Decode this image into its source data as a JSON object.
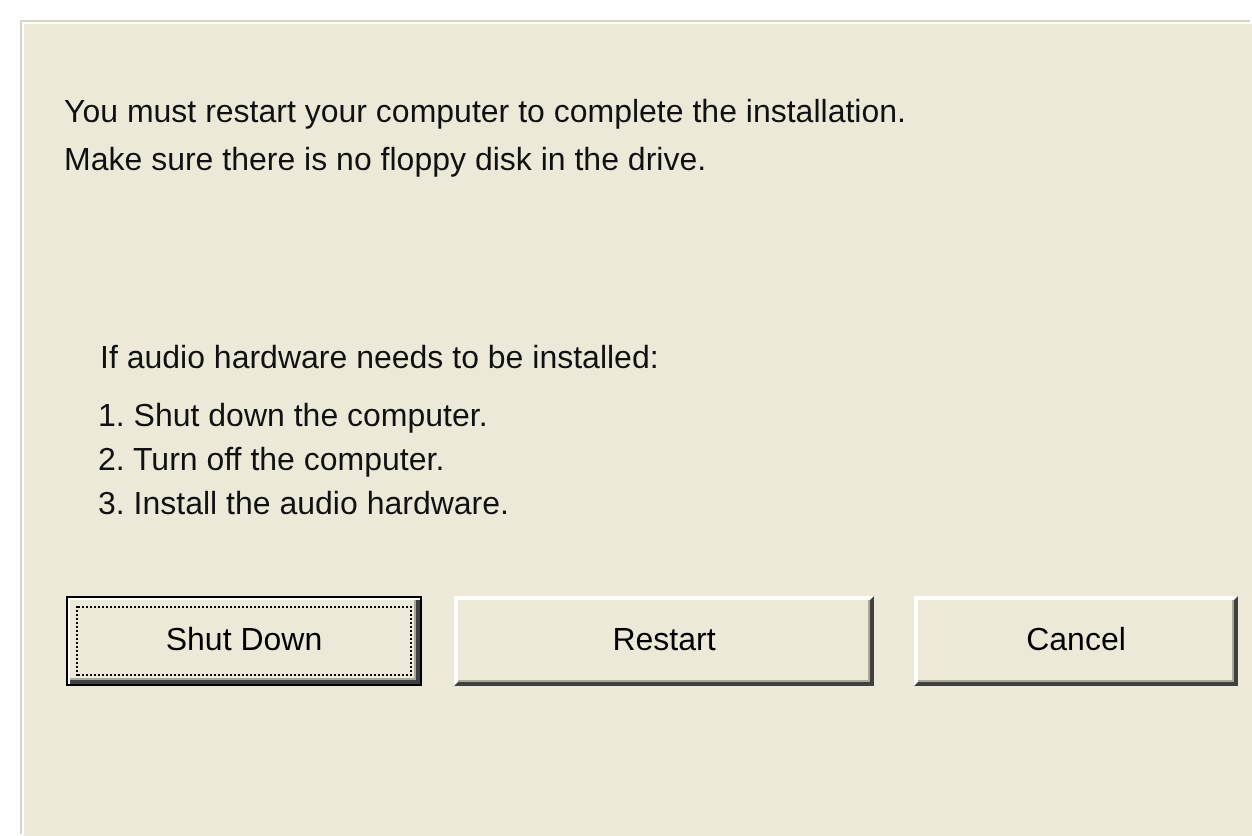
{
  "message": {
    "lines": [
      "You must restart your computer to complete the installation.",
      "Make sure there is no floppy disk in the drive."
    ]
  },
  "note": {
    "heading": "If audio hardware needs to be installed:",
    "steps": [
      "1. Shut down the computer.",
      "2. Turn off the computer.",
      "3. Install the audio hardware."
    ]
  },
  "buttons": [
    {
      "label": "Shut Down",
      "focused": true
    },
    {
      "label": "Restart",
      "focused": false
    },
    {
      "label": "Cancel",
      "focused": false
    }
  ]
}
